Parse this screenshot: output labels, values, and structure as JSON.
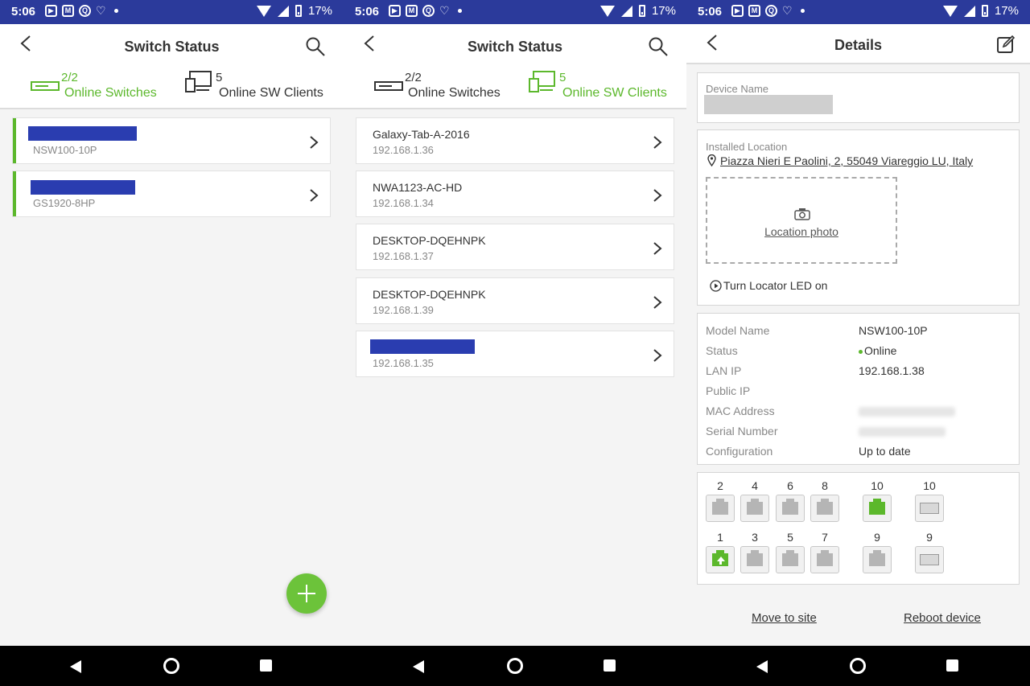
{
  "status_bar": {
    "time": "5:06",
    "battery": "17%"
  },
  "switch_status": {
    "title": "Switch Status",
    "tab_switches": {
      "count": "2/2",
      "label": "Online Switches"
    },
    "tab_clients": {
      "count": "5",
      "label": "Online SW Clients"
    }
  },
  "switches": [
    {
      "model": "NSW100-10P"
    },
    {
      "model": "GS1920-8HP"
    }
  ],
  "clients": [
    {
      "name": "Galaxy-Tab-A-2016",
      "ip": "192.168.1.36"
    },
    {
      "name": "NWA1123-AC-HD",
      "ip": "192.168.1.34"
    },
    {
      "name": "DESKTOP-DQEHNPK",
      "ip": "192.168.1.37"
    },
    {
      "name": "DESKTOP-DQEHNPK",
      "ip": "192.168.1.39"
    },
    {
      "name": "",
      "ip": "192.168.1.35"
    }
  ],
  "details": {
    "title": "Details",
    "device_name_label": "Device Name",
    "installed_location_label": "Installed Location",
    "location": "Piazza Nieri E Paolini, 2, 55049 Viareggio LU, Italy",
    "location_photo": "Location photo",
    "locator_led": "Turn Locator LED on",
    "fields": [
      {
        "k": "Model Name",
        "v": "NSW100-10P"
      },
      {
        "k": "Status",
        "v": "Online"
      },
      {
        "k": "LAN IP",
        "v": "192.168.1.38"
      },
      {
        "k": "Public IP",
        "v": ""
      },
      {
        "k": "MAC Address",
        "v": ""
      },
      {
        "k": "Serial Number",
        "v": ""
      },
      {
        "k": "Configuration",
        "v": "Up to date"
      }
    ],
    "ports_top": [
      "2",
      "4",
      "6",
      "8",
      "10",
      "10"
    ],
    "ports_bottom": [
      "1",
      "3",
      "5",
      "7",
      "9",
      "9"
    ],
    "move_to_site": "Move to site",
    "reboot_device": "Reboot device"
  },
  "colors": {
    "accent": "#5cb82c",
    "status_bar": "#2b3a9b",
    "redact": "#2a3db0"
  }
}
